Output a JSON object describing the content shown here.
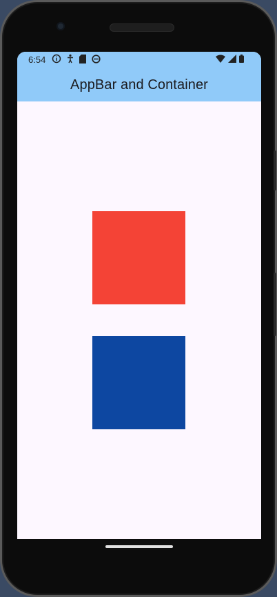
{
  "status_bar": {
    "time": "6:54",
    "left_icons": [
      "info-icon",
      "accessibility-icon",
      "sd-card-icon",
      "android-icon"
    ],
    "right_icons": [
      "wifi-icon",
      "signal-icon",
      "battery-icon"
    ]
  },
  "app_bar": {
    "title": "AppBar and Container",
    "color": "#90caf9"
  },
  "containers": [
    {
      "name": "red-container",
      "color": "#f44336"
    },
    {
      "name": "blue-container",
      "color": "#0d47a1"
    }
  ],
  "colors": {
    "background": "#fdf7ff",
    "app_bar": "#90caf9"
  }
}
